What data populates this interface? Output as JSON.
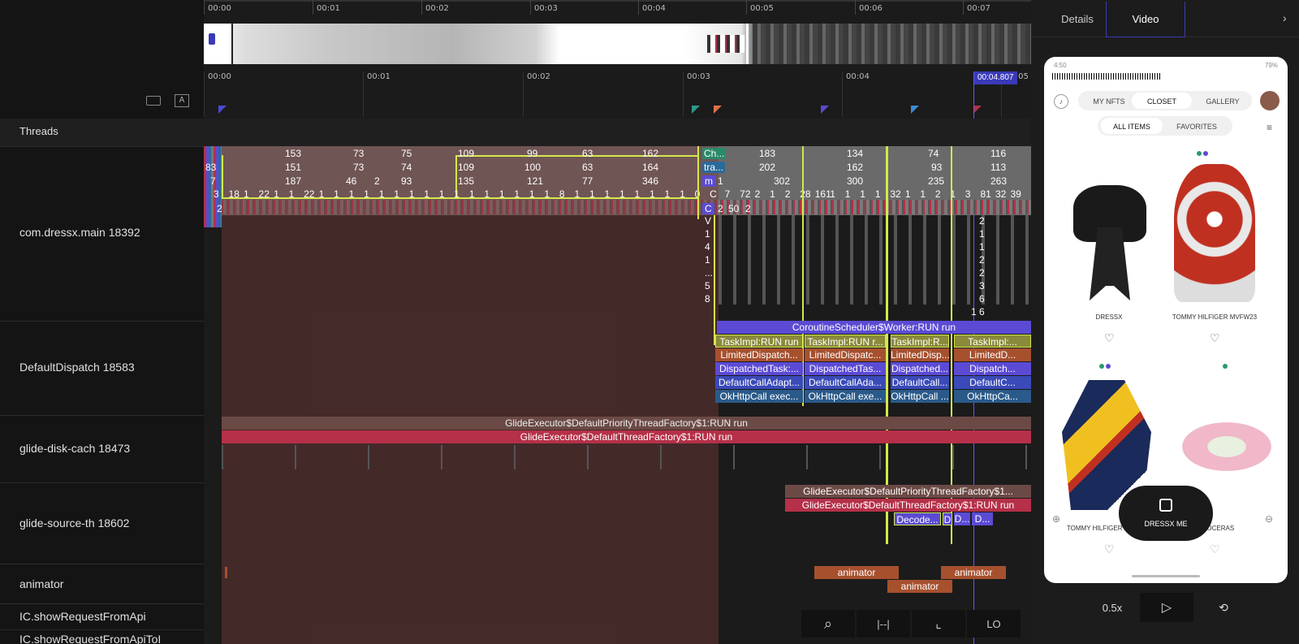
{
  "timeline": {
    "overview_ticks": [
      "00:00",
      "00:01",
      "00:02",
      "00:03",
      "00:04",
      "00:05",
      "00:06",
      "00:07"
    ],
    "detail_ticks": [
      "00:00",
      "00:01",
      "00:02",
      "00:03",
      "00:04",
      "00:05"
    ],
    "cursor_time": "00:04.807"
  },
  "section_header": "Threads",
  "tracks": [
    {
      "name": "com.dressx.main 18392"
    },
    {
      "name": "DefaultDispatch 18583"
    },
    {
      "name": "glide-disk-cach 18473"
    },
    {
      "name": "glide-source-th 18602"
    },
    {
      "name": "animator"
    },
    {
      "name": "IC.showRequestFromApi"
    },
    {
      "name": "IC.showRequestFromApiToI"
    }
  ],
  "main_numbers": {
    "row1": [
      "153",
      "73",
      "75",
      "109",
      "99",
      "63",
      "162",
      "Ch...",
      "183",
      "134",
      "74",
      "116"
    ],
    "row2": [
      "83",
      "151",
      "73",
      "74",
      "109",
      "100",
      "63",
      "164",
      "tra...",
      "202",
      "162",
      "93",
      "113"
    ],
    "row3": [
      "7",
      "187",
      "46",
      "2",
      "93",
      "135",
      "121",
      "77",
      "346",
      "m",
      "1",
      "302",
      "300",
      "235",
      "263"
    ],
    "row4": [
      "3",
      "18",
      "1",
      "22",
      "1",
      "1",
      "22",
      "1",
      "1",
      "1",
      "1",
      "1",
      "1",
      "1",
      "1",
      "1",
      "1",
      "1",
      "1",
      "1",
      "1",
      "1",
      "1",
      "8",
      "1",
      "1",
      "1",
      "1",
      "1",
      "1",
      "1",
      "1",
      "0",
      "C",
      "7",
      "72",
      "2",
      "1",
      "2",
      "28",
      "161",
      "1",
      "1",
      "1",
      "1",
      "32",
      "1",
      "1",
      "2",
      "1",
      "3",
      "81",
      "32",
      "39"
    ],
    "row5": [
      "2",
      "C",
      "2",
      "50",
      "2"
    ],
    "col_small": [
      "V",
      "1",
      "4",
      "1",
      "...",
      "5",
      "8",
      "1",
      "2",
      "1",
      "1",
      "2",
      "2",
      "3",
      "6",
      "6"
    ]
  },
  "dispatch_slices": {
    "coroutine": "CoroutineScheduler$Worker:RUN run",
    "task": [
      "TaskImpl:RUN run",
      "TaskImpl:RUN r...",
      "TaskImpl:R...",
      "TaskImpl:..."
    ],
    "limited": [
      "LimitedDispatch...",
      "LimitedDispatc...",
      "LimitedDisp...",
      "LimitedD..."
    ],
    "dispatched": [
      "DispatchedTask:...",
      "DispatchedTas...",
      "Dispatched...",
      "Dispatch..."
    ],
    "defaultcall": [
      "DefaultCallAdapt...",
      "DefaultCallAda...",
      "DefaultCall...",
      "DefaultC..."
    ],
    "okhttp": [
      "OkHttpCall exec...",
      "OkHttpCall exe...",
      "OkHttpCall ...",
      "OkHttpCa..."
    ]
  },
  "glide_disk": {
    "a": "GlideExecutor$DefaultPriorityThreadFactory$1:RUN run",
    "b": "GlideExecutor$DefaultThreadFactory$1:RUN run"
  },
  "glide_source": {
    "a": "GlideExecutor$DefaultPriorityThreadFactory$1...",
    "b": "GlideExecutor$DefaultThreadFactory$1:RUN run",
    "c": "Decode...",
    "d": [
      "D",
      "D...",
      "D..."
    ]
  },
  "animator": {
    "a": "animator",
    "b": "animator",
    "c": "animator"
  },
  "bottom_tools": {
    "zoom": "⌕",
    "range": "|--|",
    "crop": "⌞",
    "lo": "LO"
  },
  "right_panel": {
    "tabs": [
      "Details",
      "Video"
    ],
    "speed": "0.5x",
    "phone": {
      "status_time": "4:50",
      "battery": "79%",
      "nav": [
        "MY NFTS",
        "CLOSET",
        "GALLERY"
      ],
      "filters": [
        "ALL ITEMS",
        "FAVORITES"
      ],
      "items": [
        {
          "caption": "DRESSX"
        },
        {
          "caption": "TOMMY HILFIGER MVFW23"
        },
        {
          "caption": "TOMMY HILFIGER MVFW23"
        },
        {
          "caption": "PALOCERAS"
        }
      ],
      "cta": "DRESSX ME"
    }
  },
  "colors": {
    "accent": "#3a3ab8",
    "selection": "#d4e84a",
    "purple": "#5b4bd4",
    "red": "#b53048",
    "brown": "#6b4a45",
    "orange": "#a6502e"
  }
}
